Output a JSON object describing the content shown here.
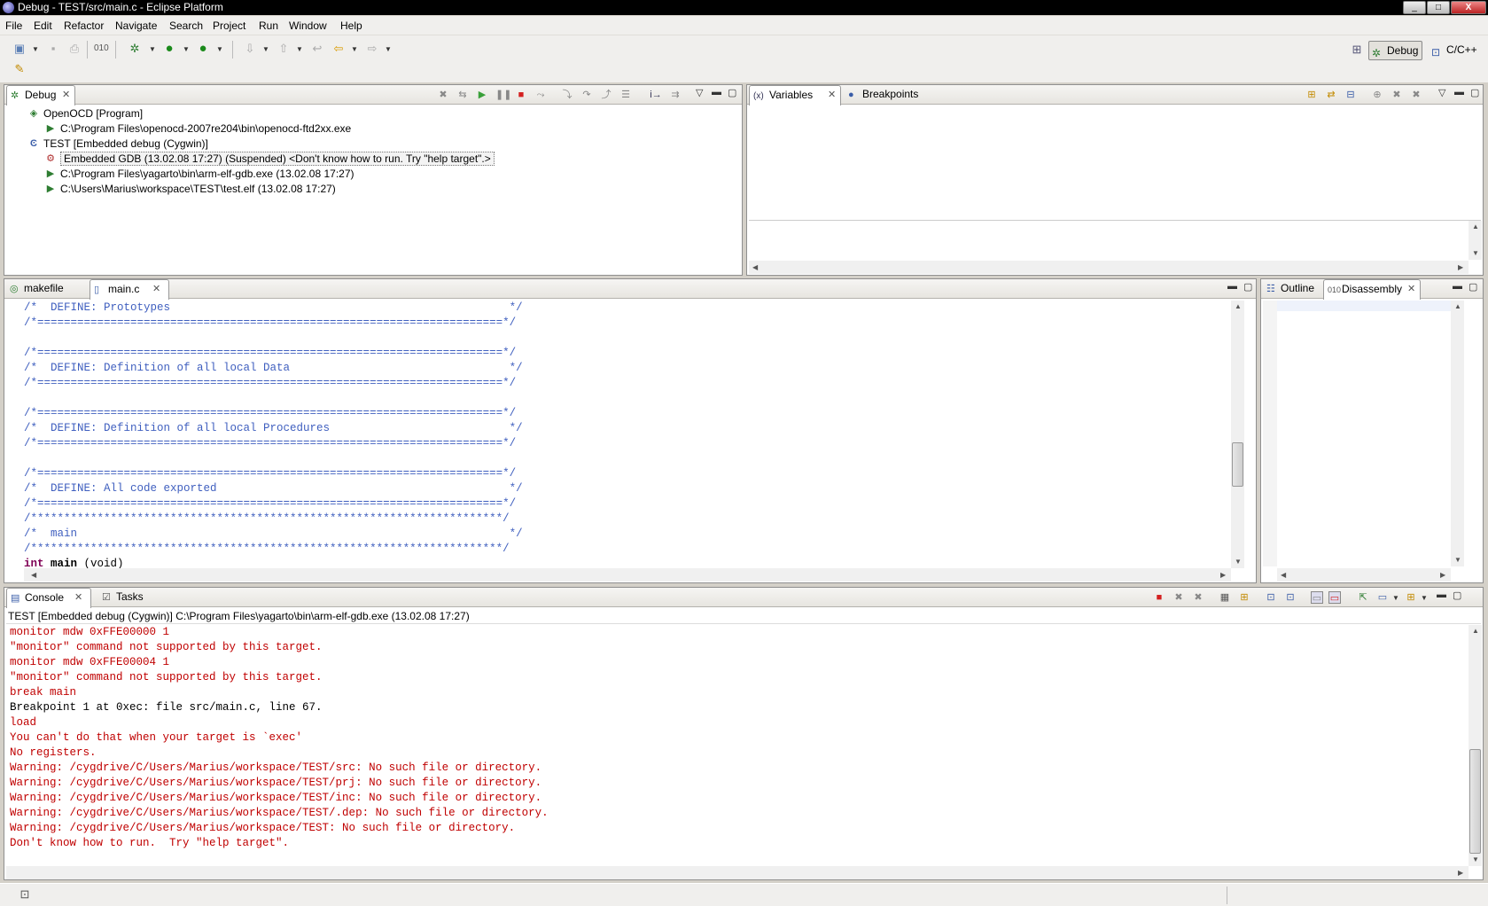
{
  "window": {
    "title": "Debug - TEST/src/main.c - Eclipse Platform",
    "controls": [
      "_",
      "□",
      "X"
    ]
  },
  "menu": [
    "File",
    "Edit",
    "Refactor",
    "Navigate",
    "Search",
    "Project",
    "Run",
    "Window",
    "Help"
  ],
  "perspectives": [
    {
      "label": "Debug",
      "icon": "debug-perspective-icon"
    },
    {
      "label": "C/C++",
      "icon": "cpp-perspective-icon"
    }
  ],
  "debug_view": {
    "tab": "Debug",
    "tree": [
      {
        "label": "OpenOCD [Program]",
        "icon": "launch-icon"
      },
      {
        "label": "C:\\Program Files\\openocd-2007re204\\bin\\openocd-ftd2xx.exe",
        "icon": "process-icon"
      },
      {
        "label": "TEST [Embedded debug (Cygwin)]",
        "icon": "c-launch-icon"
      },
      {
        "label": "Embedded GDB (13.02.08 17:27) (Suspended) <Don't know how to run.  Try \"help target\".>",
        "icon": "suspended-target-icon"
      },
      {
        "label": "C:\\Program Files\\yagarto\\bin\\arm-elf-gdb.exe (13.02.08 17:27)",
        "icon": "process-icon"
      },
      {
        "label": "C:\\Users\\Marius\\workspace\\TEST\\test.elf (13.02.08 17:27)",
        "icon": "process-icon"
      }
    ]
  },
  "variables_view": {
    "tabs": [
      "Variables",
      "Breakpoints"
    ]
  },
  "editor": {
    "tabs": [
      "makefile",
      "main.c"
    ],
    "lines": [
      "/*  DEFINE: Prototypes                                                   */",
      "/*======================================================================*/",
      "",
      "/*======================================================================*/",
      "/*  DEFINE: Definition of all local Data                                 */",
      "/*======================================================================*/",
      "",
      "/*======================================================================*/",
      "/*  DEFINE: Definition of all local Procedures                           */",
      "/*======================================================================*/",
      "",
      "/*======================================================================*/",
      "/*  DEFINE: All code exported                                            */",
      "/*======================================================================*/",
      "/***********************************************************************/",
      "/*  main                                                                 */",
      "/***********************************************************************/"
    ],
    "code_last": {
      "kw1": "int",
      "kw2": "main",
      "rest": " (void)"
    }
  },
  "outline_view": {
    "tabs": [
      "Outline",
      "Disassembly"
    ]
  },
  "console": {
    "tabs": [
      "Console",
      "Tasks"
    ],
    "header": "TEST [Embedded debug (Cygwin)] C:\\Program Files\\yagarto\\bin\\arm-elf-gdb.exe (13.02.08 17:27)",
    "lines": [
      {
        "text": "monitor mdw 0xFFE00000 1",
        "color": "#c00000"
      },
      {
        "text": "\"monitor\" command not supported by this target.",
        "color": "#c00000"
      },
      {
        "text": "monitor mdw 0xFFE00004 1",
        "color": "#c00000"
      },
      {
        "text": "\"monitor\" command not supported by this target.",
        "color": "#c00000"
      },
      {
        "text": "break main",
        "color": "#c00000"
      },
      {
        "text": "Breakpoint 1 at 0xec: file src/main.c, line 67.",
        "color": "#000000"
      },
      {
        "text": "load",
        "color": "#c00000"
      },
      {
        "text": "You can't do that when your target is `exec'",
        "color": "#c00000"
      },
      {
        "text": "No registers.",
        "color": "#c00000"
      },
      {
        "text": "Warning: /cygdrive/C/Users/Marius/workspace/TEST/src: No such file or directory.",
        "color": "#c00000"
      },
      {
        "text": "Warning: /cygdrive/C/Users/Marius/workspace/TEST/prj: No such file or directory.",
        "color": "#c00000"
      },
      {
        "text": "Warning: /cygdrive/C/Users/Marius/workspace/TEST/inc: No such file or directory.",
        "color": "#c00000"
      },
      {
        "text": "Warning: /cygdrive/C/Users/Marius/workspace/TEST/.dep: No such file or directory.",
        "color": "#c00000"
      },
      {
        "text": "Warning: /cygdrive/C/Users/Marius/workspace/TEST: No such file or directory.",
        "color": "#c00000"
      },
      {
        "text": "Don't know how to run.  Try \"help target\".",
        "color": "#c00000"
      }
    ]
  }
}
